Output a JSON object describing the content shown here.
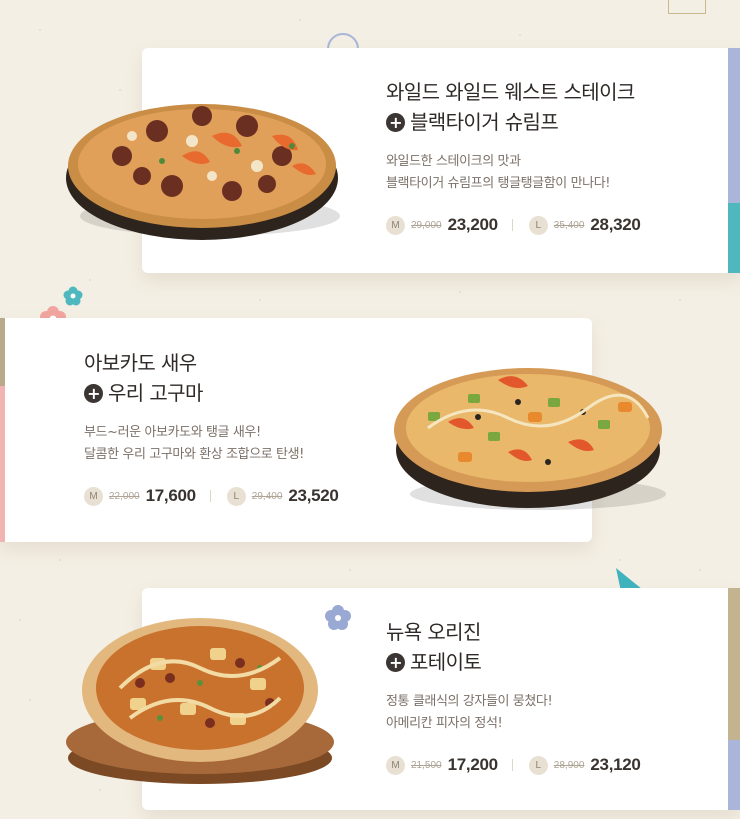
{
  "colors": {
    "background": "#f4efe4",
    "card": "#ffffff",
    "accent_blue": "#a9b6d9",
    "accent_teal": "#4fb8bf",
    "accent_olive": "#b7a98a",
    "accent_pink": "#f2b3b3",
    "accent_tan": "#c3b48f"
  },
  "products": [
    {
      "title_line1": "와일드 와일드 웨스트 스테이크",
      "title_line2": "블랙타이거 슈림프",
      "plus_icon": "plus-circle-icon",
      "desc_line1": "와일드한 스테이크의 맛과",
      "desc_line2": "블랙타이거 슈림프의 탱글탱글함이 만나다!",
      "medium": {
        "size_label": "M",
        "old_price": "29,000",
        "price": "23,200"
      },
      "large": {
        "size_label": "L",
        "old_price": "35,400",
        "price": "28,320"
      }
    },
    {
      "title_line1": "아보카도 새우",
      "title_line2": "우리 고구마",
      "plus_icon": "plus-circle-icon",
      "desc_line1": "부드~러운 아보카도와 탱글 새우!",
      "desc_line2": "달콤한 우리 고구마와 환상 조합으로 탄생!",
      "medium": {
        "size_label": "M",
        "old_price": "22,000",
        "price": "17,600"
      },
      "large": {
        "size_label": "L",
        "old_price": "29,400",
        "price": "23,520"
      }
    },
    {
      "title_line1": "뉴욕 오리진",
      "title_line2": "포테이토",
      "plus_icon": "plus-circle-icon",
      "desc_line1": "정통 클래식의 강자들이 뭉쳤다!",
      "desc_line2": "아메리칸 피자의 정석!",
      "medium": {
        "size_label": "M",
        "old_price": "21,500",
        "price": "17,200"
      },
      "large": {
        "size_label": "L",
        "old_price": "28,900",
        "price": "23,120"
      }
    }
  ]
}
